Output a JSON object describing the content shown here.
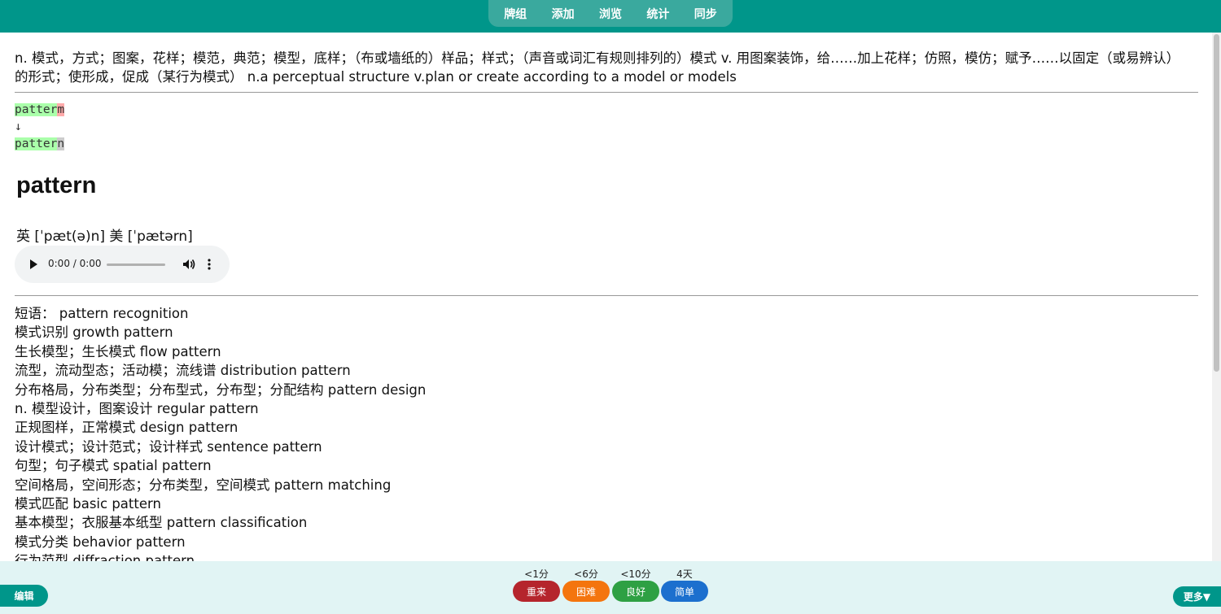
{
  "nav": {
    "items": [
      {
        "label": "牌组"
      },
      {
        "label": "添加"
      },
      {
        "label": "浏览"
      },
      {
        "label": "统计"
      },
      {
        "label": "同步"
      }
    ]
  },
  "card": {
    "definition": "n. 模式，方式；图案，花样；模范，典范；模型，底样；（布或墙纸的）样品；样式；（声音或词汇有规则排列的）模式 v. 用图案装饰，给……加上花样；仿照，模仿；赋予……以固定（或易辨认）的形式；使形成，促成（某行为模式） n.a perceptual structure v.plan or create according to a model or models",
    "typed_correct_part": "patter",
    "typed_wrong_part": "m",
    "arrow": "↓",
    "expected_correct_part": "patter",
    "expected_missing_part": "n",
    "word": "pattern",
    "phonetic": "英 [ˈpæt(ə)n] 美 [ˈpætərn]",
    "audio_time": "0:00 / 0:00",
    "phrases": [
      "短语：  pattern recognition",
      "模式识别 growth pattern",
      "生长模型；生长模式 flow pattern",
      "流型，流动型态；活动模；流线谱 distribution pattern",
      "分布格局，分布类型；分布型式，分布型；分配结构 pattern design",
      "n. 模型设计，图案设计 regular pattern",
      "正规图样，正常模式 design pattern",
      "设计模式；设计范式；设计样式 sentence pattern",
      "句型；句子模式 spatial pattern",
      "空间格局，空间形态；分布类型，空间模式 pattern matching",
      "模式匹配 basic pattern",
      "基本模型；衣服基本纸型 pattern classification",
      "模式分类 behavior pattern",
      "行为范型 diffraction pattern"
    ]
  },
  "answers": {
    "again": {
      "interval": "<1分",
      "label": "重来",
      "color": "#b5252c"
    },
    "hard": {
      "interval": "<6分",
      "label": "困难",
      "color": "#f4750e"
    },
    "good": {
      "interval": "<10分",
      "label": "良好",
      "color": "#2ea043"
    },
    "easy": {
      "interval": "4天",
      "label": "简单",
      "color": "#1c6fce"
    }
  },
  "bottom": {
    "edit_label": "编辑",
    "more_label": "更多▼"
  }
}
